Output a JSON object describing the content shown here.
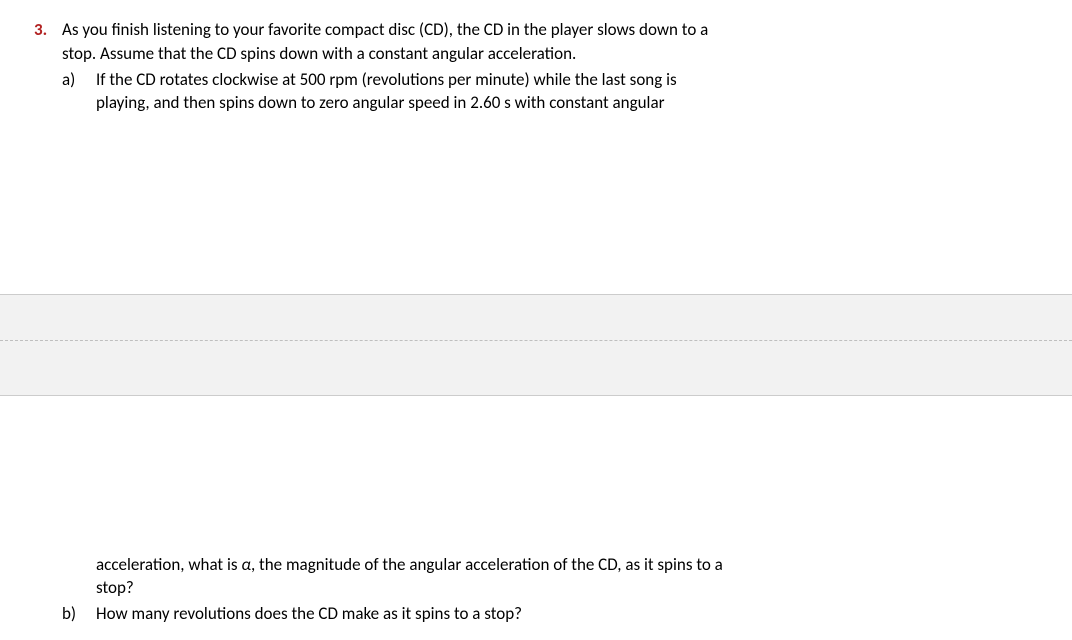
{
  "question": {
    "number": "3.",
    "intro_line1": "As you finish listening to your favorite compact disc (CD), the CD in the player slows down to a",
    "intro_line2": "stop. Assume that the CD spins down with a constant angular acceleration.",
    "partA": {
      "label": "a)",
      "line1": "If the CD rotates clockwise at 500 rpm (revolutions per minute) while the last song is",
      "line2": "playing, and then spins down to zero angular speed in 2.60 s with constant angular",
      "line3_pre": "acceleration, what is ",
      "line3_var": "α",
      "line3_post": ", the magnitude of the angular acceleration of the CD, as it spins to a",
      "line4": "stop?"
    },
    "partB": {
      "label": "b)",
      "text": "How many revolutions does the CD make as it spins to a stop?"
    }
  }
}
